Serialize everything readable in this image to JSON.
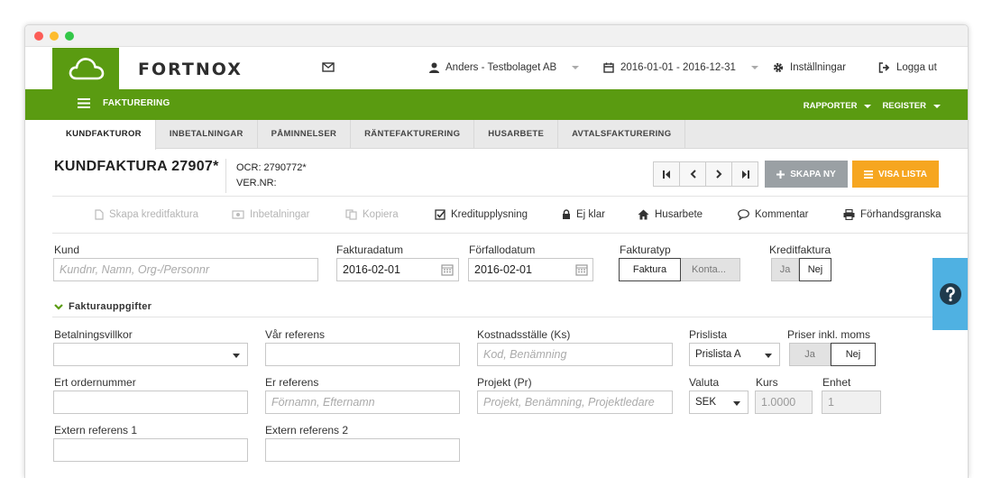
{
  "topbar": {
    "brand": "FORTNOX",
    "user": "Anders - Testbolaget AB",
    "period": "2016-01-01 - 2016-12-31",
    "settings": "Inställningar",
    "logout": "Logga ut"
  },
  "greenbar": {
    "section": "FAKTURERING",
    "reports": "RAPPORTER",
    "register": "REGISTER"
  },
  "tabs": [
    "KUNDFAKTUROR",
    "INBETALNINGAR",
    "PÅMINNELSER",
    "RÄNTEFAKTURERING",
    "HUSARBETE",
    "AVTALSFAKTURERING"
  ],
  "header": {
    "title": "KUNDFAKTURA 27907*",
    "ocr": "OCR: 2790772*",
    "vernr": "VER.NR:",
    "create_new": "SKAPA NY",
    "show_list": "VISA LISTA"
  },
  "toolbar": {
    "credit_invoice": "Skapa kreditfaktura",
    "payments": "Inbetalningar",
    "copy": "Kopiera",
    "credit_info": "Kreditupplysning",
    "not_done": "Ej klar",
    "house_work": "Husarbete",
    "comment": "Kommentar",
    "preview": "Förhandsgranska"
  },
  "form": {
    "customer_label": "Kund",
    "customer_placeholder": "Kundnr, Namn, Org-/Personnr",
    "invoice_date_label": "Fakturadatum",
    "invoice_date": "2016-02-01",
    "due_date_label": "Förfallodatum",
    "due_date": "2016-02-01",
    "invoice_type_label": "Fakturatyp",
    "invoice_type_options": [
      "Faktura",
      "Konta..."
    ],
    "credit_label": "Kreditfaktura",
    "credit_options": [
      "Ja",
      "Nej"
    ],
    "section_title": "Fakturauppgifter",
    "payment_terms_label": "Betalningsvillkor",
    "our_ref_label": "Vår referens",
    "cost_center_label": "Kostnadsställe (Ks)",
    "cost_center_placeholder": "Kod, Benämning",
    "pricelist_label": "Prislista",
    "pricelist_value": "Prislista A",
    "price_incl_vat_label": "Priser inkl. moms",
    "price_incl_vat_options": [
      "Ja",
      "Nej"
    ],
    "order_no_label": "Ert ordernummer",
    "your_ref_label": "Er referens",
    "your_ref_placeholder": "Förnamn, Efternamn",
    "project_label": "Projekt (Pr)",
    "project_placeholder": "Projekt, Benämning, Projektledare",
    "currency_label": "Valuta",
    "currency_value": "SEK",
    "rate_label": "Kurs",
    "rate_value": "1.0000",
    "unit_label": "Enhet",
    "unit_value": "1",
    "ext_ref1_label": "Extern referens 1",
    "ext_ref2_label": "Extern referens 2"
  }
}
